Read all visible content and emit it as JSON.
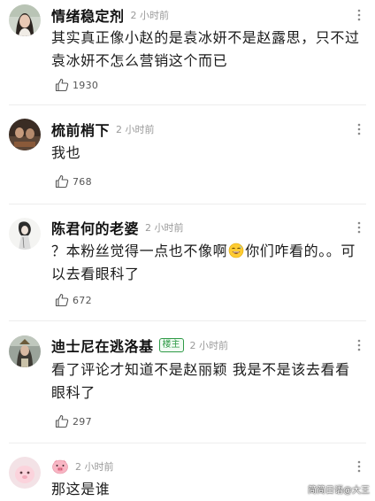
{
  "comments": [
    {
      "username": "情绪稳定剂",
      "time": "2 小时前",
      "text": "其实真正像小赵的是袁冰妍不是赵露思，只不过袁冰妍不怎么营销这个而已",
      "likes": "1930",
      "avatar_icon": "user-avatar-woman-portrait"
    },
    {
      "username": "梳前梢下",
      "time": "2 小时前",
      "text": "我也",
      "likes": "768",
      "avatar_icon": "user-avatar-dark-photo"
    },
    {
      "username": "陈君何的老婆",
      "time": "2 小时前",
      "text_before_emoji": "？本粉丝觉得一点也不像啊",
      "emoji": "grinning-sweat-emoji",
      "text_after_emoji": "你们咋看的。。可以去看眼科了",
      "likes": "672",
      "avatar_icon": "user-avatar-ink-figure"
    },
    {
      "username": "迪士尼在逃洛基",
      "badge": "楼主",
      "time": "2 小时前",
      "text": "看了评论才知道不是赵丽颖 我是不是该去看看眼科了",
      "likes": "297",
      "avatar_icon": "user-avatar-costume-figure"
    },
    {
      "username_emoji": "pig-face-emoji",
      "time": "2 小时前",
      "text": "那这是谁",
      "avatar_icon": "user-avatar-pink-cartoon"
    }
  ],
  "watermark": "简简日语@大王",
  "icons": {
    "like": "thumbs-up-outline-icon",
    "more": "more-options-icon"
  },
  "colors": {
    "time_gray": "#9a9a9a",
    "badge_green": "#2e9a46",
    "text": "#1b1b1b"
  }
}
